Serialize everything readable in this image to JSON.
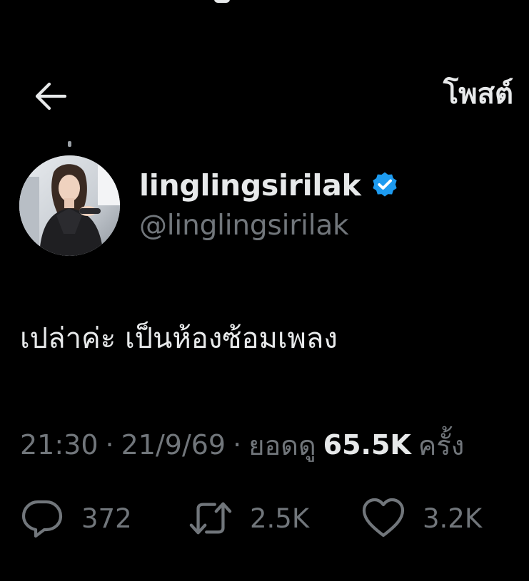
{
  "header": {
    "title": "โพสต์",
    "back_icon": "back-arrow-icon"
  },
  "author": {
    "display_name": "linglingsirilak",
    "handle": "@linglingsirilak",
    "verified_icon": "verified-badge-icon",
    "verified_color": "#1d9bf0"
  },
  "tweet": {
    "text": "เปล่าค่ะ เป็นห้องซ้อมเพลง"
  },
  "meta": {
    "time": "21:30",
    "separator": "·",
    "date": "21/9/69",
    "views_label": "ยอดดู",
    "views_count": "65.5K",
    "views_suffix": "ครั้ง"
  },
  "actions": {
    "reply": {
      "icon": "reply-icon",
      "count": "372"
    },
    "repost": {
      "icon": "repost-icon",
      "count": "2.5K"
    },
    "like": {
      "icon": "heart-icon",
      "count": "3.2K"
    }
  },
  "colors": {
    "background": "#000000",
    "primary_text": "#e7e9ea",
    "secondary_text": "#71767b",
    "accent": "#1d9bf0"
  }
}
